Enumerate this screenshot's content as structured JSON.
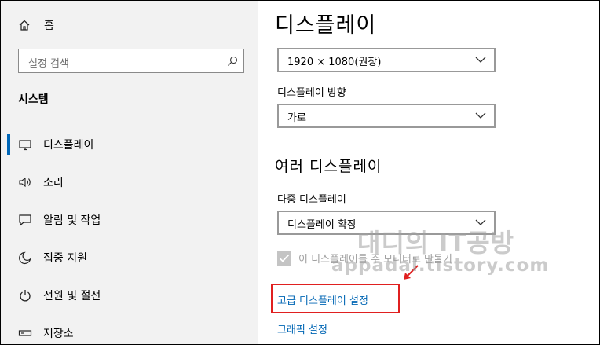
{
  "sidebar": {
    "home_label": "홈",
    "search_placeholder": "설정 검색",
    "section_title": "시스템",
    "items": [
      {
        "label": "디스플레이",
        "icon": "monitor-icon",
        "active": true
      },
      {
        "label": "소리",
        "icon": "speaker-icon"
      },
      {
        "label": "알림 및 작업",
        "icon": "notification-icon"
      },
      {
        "label": "집중 지원",
        "icon": "moon-icon"
      },
      {
        "label": "전원 및 절전",
        "icon": "power-icon"
      },
      {
        "label": "저장소",
        "icon": "storage-icon"
      }
    ]
  },
  "main": {
    "title": "디스플레이",
    "resolution_value": "1920 × 1080(권장)",
    "orientation_label": "디스플레이 방향",
    "orientation_value": "가로",
    "multi_display_heading": "여러 디스플레이",
    "multi_display_label": "다중 디스플레이",
    "multi_display_value": "디스플레이 확장",
    "main_display_checkbox_label": "이 디스플레이를 주 모니터로 만들기",
    "main_display_checked": true,
    "advanced_link": "고급 디스플레이 설정",
    "graphics_link": "그래픽 설정"
  },
  "watermark": {
    "line1": "대디의 IT공방",
    "line2": "appadal.tistory.com"
  },
  "colors": {
    "accent": "#0067b8",
    "link": "#0066b4",
    "highlight": "#e02020"
  }
}
